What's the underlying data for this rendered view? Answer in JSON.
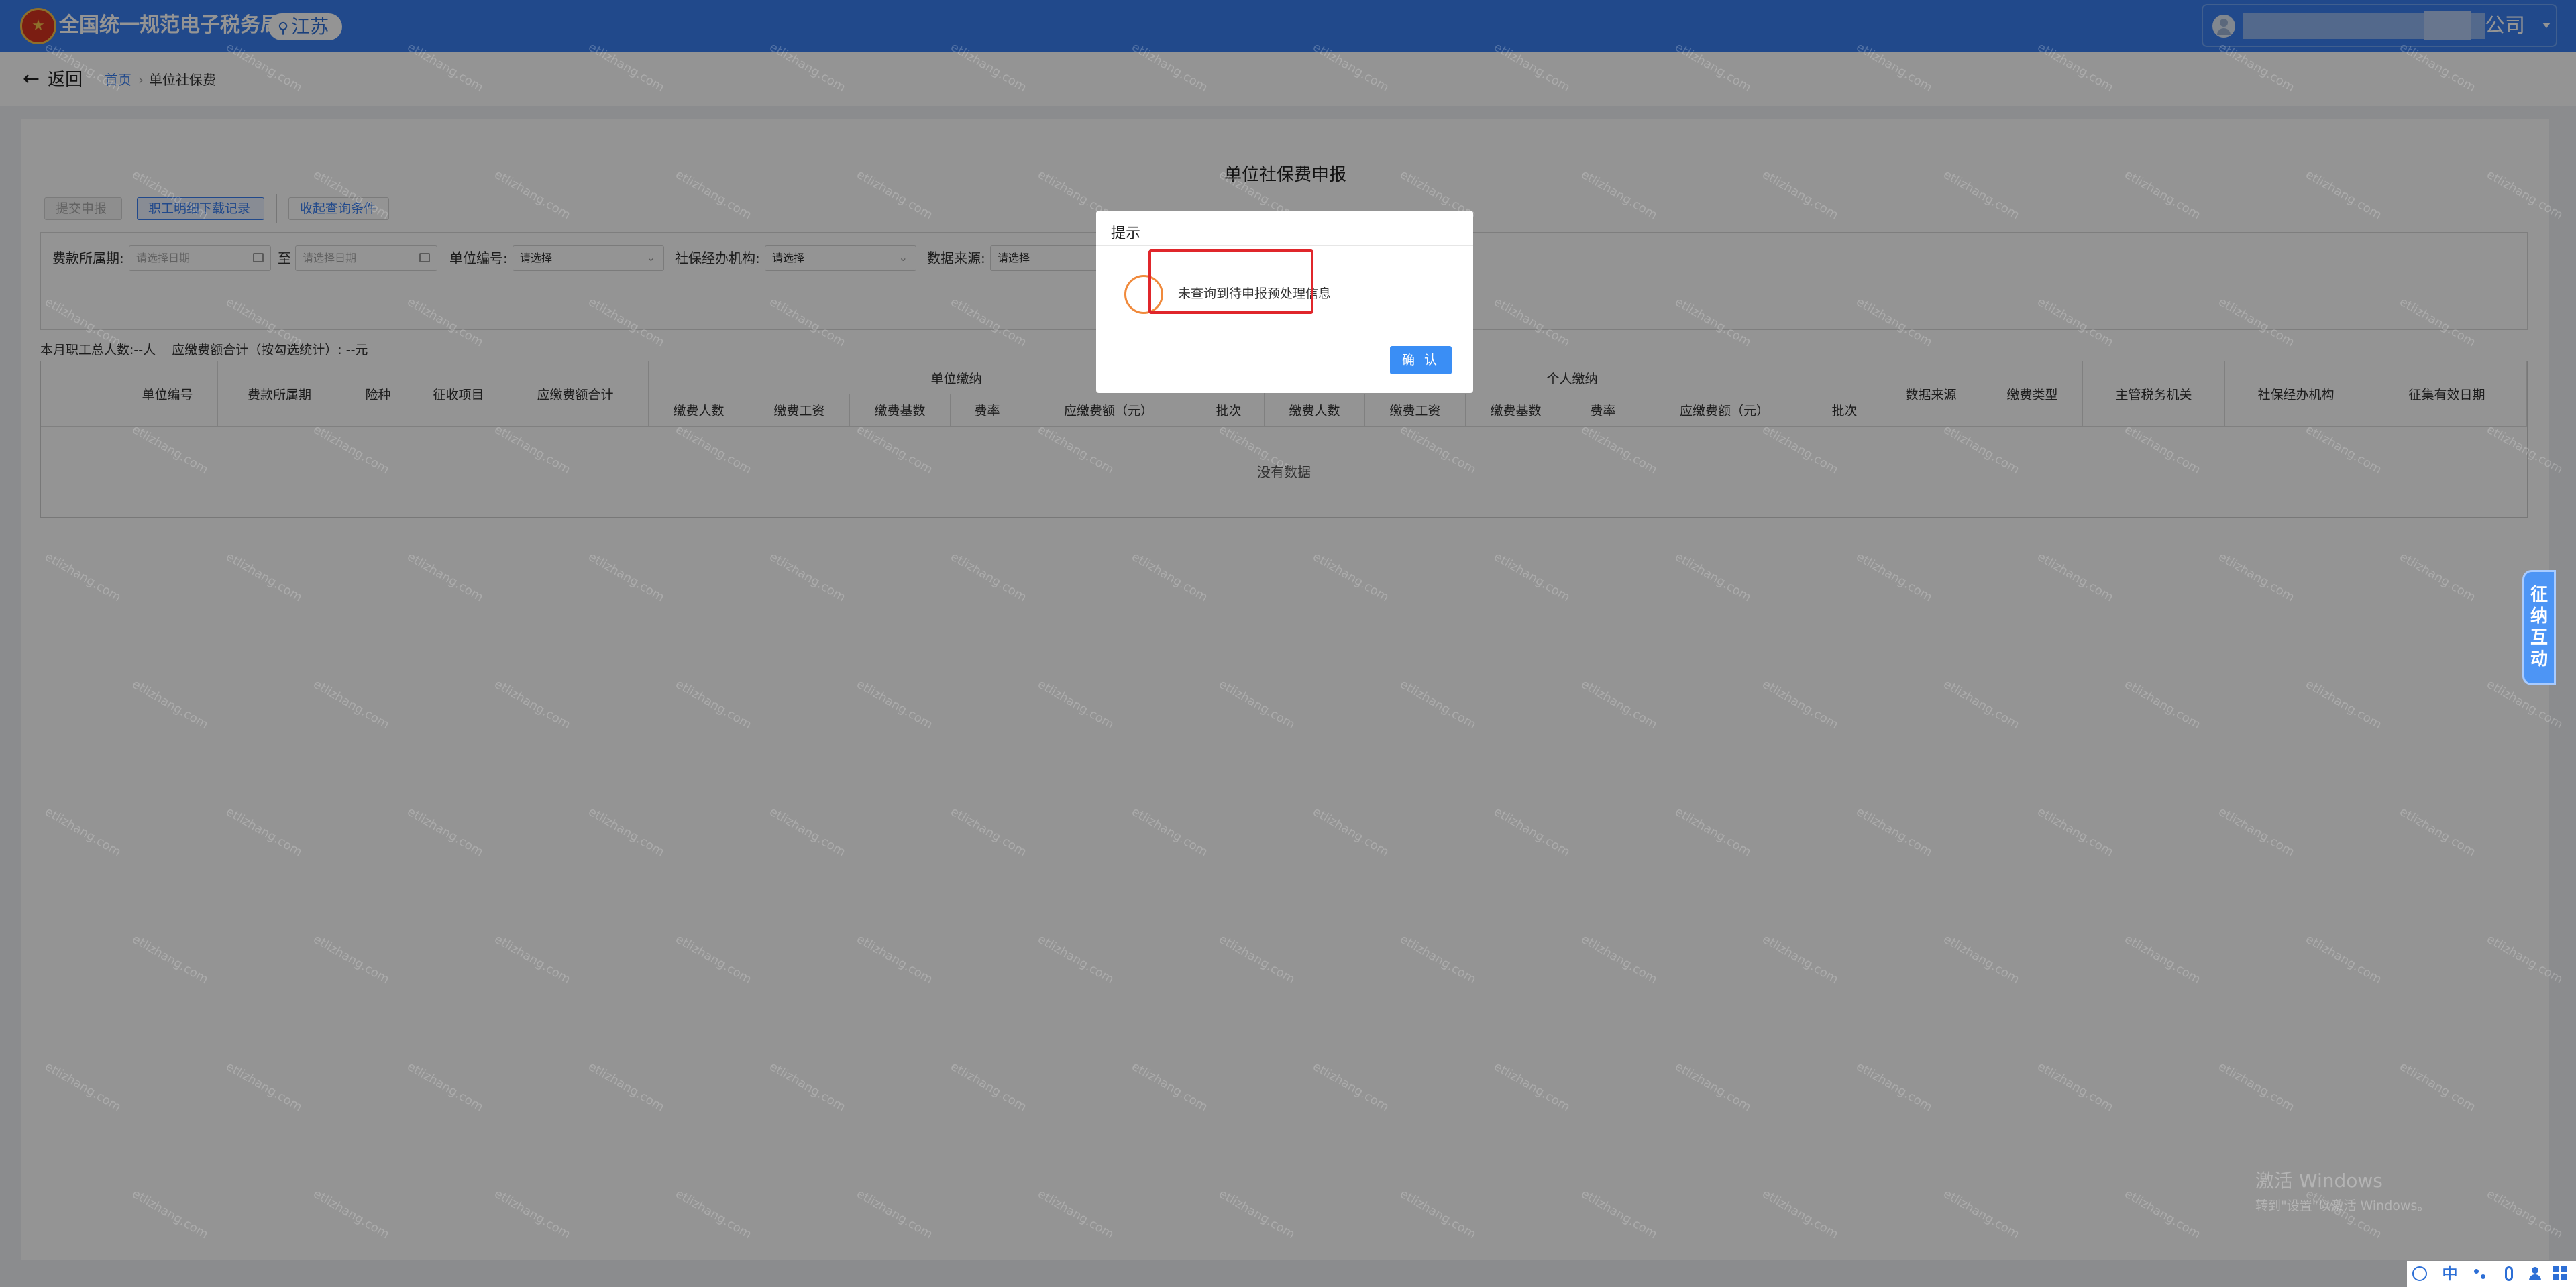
{
  "header": {
    "brand": "全国统一规范电子税务局",
    "region": "江苏",
    "company_suffix": "公司"
  },
  "breadcrumb": {
    "back": "返回",
    "home": "首页",
    "separator": "›",
    "current": "单位社保费"
  },
  "page": {
    "title": "单位社保费申报"
  },
  "toolbar": {
    "submit": "提交申报",
    "download": "职工明细下载记录",
    "collapse": "收起查询条件"
  },
  "filters": {
    "period_label": "费款所属期:",
    "date_placeholder": "请选择日期",
    "to": "至",
    "unit_no_label": "单位编号:",
    "agency_label": "社保经办机构:",
    "source_label": "数据来源:",
    "select_placeholder": "请选择"
  },
  "summary": {
    "text": "本月职工总人数:--人    应缴费额合计（按勾选统计）: --元"
  },
  "table": {
    "fixed_columns": [
      "单位编号",
      "费款所属期",
      "险种",
      "征收项目",
      "应缴费额合计"
    ],
    "unit_group": "单位缴纳",
    "person_group": "个人缴纳",
    "unit_columns": [
      "缴费人数",
      "缴费工资",
      "缴费基数",
      "费率",
      "应缴费额（元）",
      "批次"
    ],
    "person_columns": [
      "缴费人数",
      "缴费工资",
      "缴费基数",
      "费率",
      "应缴费额（元）",
      "批次"
    ],
    "tail_columns": [
      "数据来源",
      "缴费类型",
      "主管税务机关",
      "社保经办机构",
      "征集有效日期"
    ],
    "empty": "没有数据"
  },
  "dialog": {
    "title": "提示",
    "message": "未查询到待申报预处理信息",
    "ok": "确 认"
  },
  "side_widget": {
    "label": "征纳互动"
  },
  "os": {
    "activate_title": "激活 Windows",
    "activate_sub": "转到\"设置\"以激活 Windows。",
    "ime_lang": "中"
  },
  "watermark_text": "etlizhang.com"
}
